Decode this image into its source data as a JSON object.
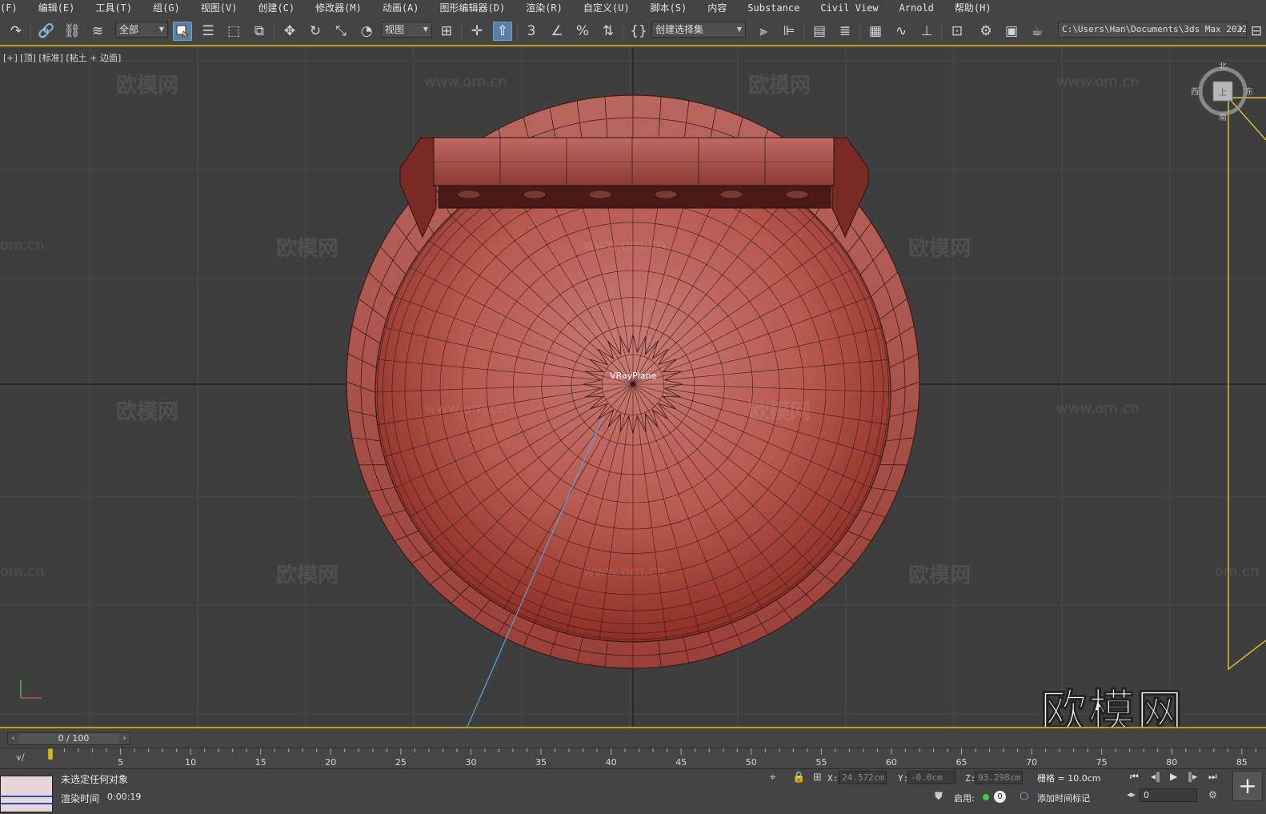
{
  "menu": [
    "(F)",
    "编辑(E)",
    "工具(T)",
    "组(G)",
    "视图(V)",
    "创建(C)",
    "修改器(M)",
    "动画(A)",
    "图形编辑器(D)",
    "渲染(R)",
    "自定义(U)",
    "脚本(S)",
    "内容",
    "Substance",
    "Civil View",
    "Arnold",
    "帮助(H)"
  ],
  "toolbar": {
    "selection_filter": "全部",
    "ref_coord": "视图",
    "named_selection": "创建选择集",
    "path": "C:\\Users\\Han\\Documents\\3ds Max 2022"
  },
  "viewport": {
    "label": "[+] [顶] [标准] [粘土 + 边面]",
    "object_label": "VRayPlane",
    "watermark": "欧模网",
    "watermark_url": "www.om.cn",
    "watermark_url_partial": "om.cn",
    "brand_logo": "欧模网",
    "viewcube": {
      "north": "北",
      "west": "西",
      "east": "东",
      "south": "南",
      "face": "上"
    },
    "colors": {
      "model": "#b5524a",
      "model_edge": "#3a1a18",
      "grid": "#4d4d4d",
      "axis": "#141414",
      "light": "#e8c62a",
      "line": "#5aa0e0"
    }
  },
  "timeline": {
    "slider": "0 / 100",
    "ticks": [
      "5",
      "10",
      "15",
      "20",
      "25",
      "30",
      "35",
      "40",
      "45",
      "50",
      "55",
      "60",
      "65",
      "70",
      "75",
      "80",
      "85"
    ]
  },
  "status": {
    "selection": "未选定任何对象",
    "render_time_label": "渲染时间",
    "render_time": "0:00:19",
    "x_label": "X:",
    "x_value": "24.572cm",
    "y_label": "Y:",
    "y_value": "-0.0cm",
    "z_label": "Z:",
    "z_value": "93.298cm",
    "grid": "栅格 = 10.0cm",
    "enable_label": "启用:",
    "enable_value": "0",
    "add_time_tag": "添加时间标记",
    "frame": "0"
  }
}
